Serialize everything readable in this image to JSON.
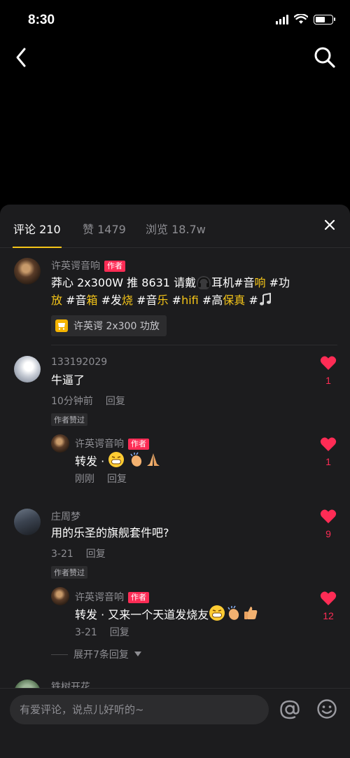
{
  "status_bar": {
    "time": "8:30"
  },
  "tabs": [
    {
      "label": "评论 210"
    },
    {
      "label": "赞 1479"
    },
    {
      "label": "浏览 18.7w"
    }
  ],
  "post": {
    "author": "许英谔音响",
    "author_tag": "作者",
    "text_part1": "莽心 2x300W 推 8631 请戴",
    "text_part2": "耳机#音",
    "kw_xiang": "响",
    "kw_gong": " #功",
    "kw_fang": "放",
    "t_a": " #音",
    "kw_xiang2": "箱",
    "t_b": " #发",
    "kw_shao": "烧",
    "t_c": " #音",
    "kw_le": "乐",
    "t_d": " #",
    "kw_hifi": "hifi",
    "t_e": " #高",
    "kw_bao": "保真",
    "t_f": " #",
    "product_label": "许英谔 2x300 功放"
  },
  "comments": [
    {
      "user": "133192029",
      "text": "牛逼了",
      "time": "10分钟前",
      "reply_label": "回复",
      "liked_tag": "作者赞过",
      "likes": "1",
      "reply": {
        "user": "许英谔音响",
        "tag": "作者",
        "text": "转发 · ",
        "time": "刚刚",
        "reply_label": "回复",
        "likes": "1"
      }
    },
    {
      "user": "庄周梦",
      "text": "用的乐圣的旗舰套件吧?",
      "time": "3-21",
      "reply_label": "回复",
      "liked_tag": "作者赞过",
      "likes": "9",
      "reply": {
        "user": "许英谔音响",
        "tag": "作者",
        "text": "转发 · 又来一个天道发烧友",
        "time": "3-21",
        "reply_label": "回复",
        "likes": "12"
      },
      "expand_label": "展开7条回复"
    },
    {
      "user": "铁树开花"
    }
  ],
  "input": {
    "placeholder": "有爱评论，说点儿好听的~"
  },
  "colors": {
    "accent_yellow": "#f5c518",
    "like_red": "#fe2c55",
    "sheet_bg": "#1c1c1e"
  }
}
